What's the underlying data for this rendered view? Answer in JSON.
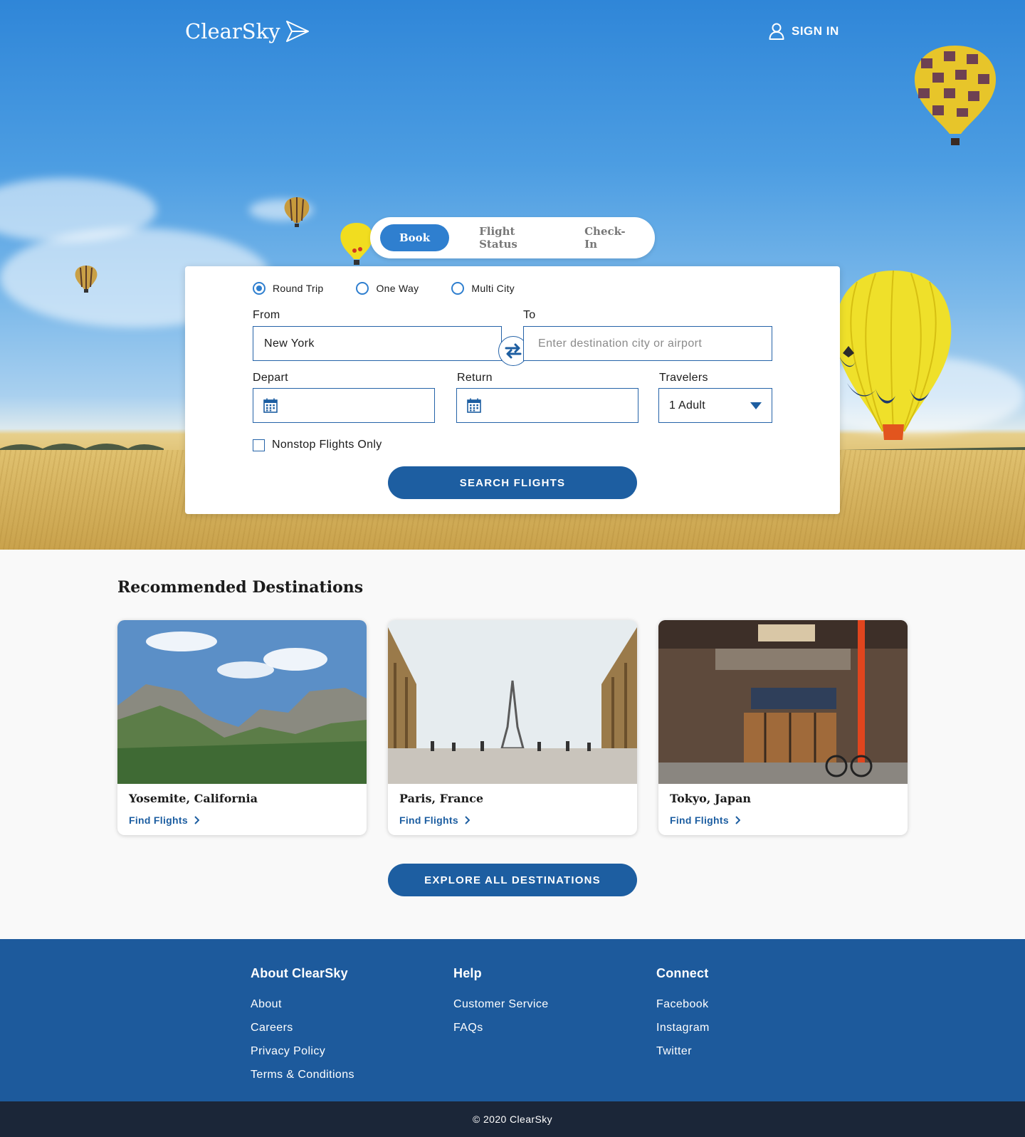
{
  "header": {
    "logo_text": "ClearSky",
    "logo_icon": "paper-plane-icon",
    "signin_label": "SIGN IN",
    "signin_icon": "user-icon"
  },
  "booking_tabs": [
    {
      "label": "Book",
      "active": true
    },
    {
      "label": "Flight Status",
      "active": false
    },
    {
      "label": "Check-In",
      "active": false
    }
  ],
  "trip_types": [
    {
      "label": "Round Trip",
      "selected": true
    },
    {
      "label": "One Way",
      "selected": false
    },
    {
      "label": "Multi City",
      "selected": false
    }
  ],
  "form": {
    "from_label": "From",
    "from_value": "New York",
    "to_label": "To",
    "to_placeholder": "Enter destination city or airport",
    "depart_label": "Depart",
    "return_label": "Return",
    "travelers_label": "Travelers",
    "travelers_value": "1 Adult",
    "nonstop_label": "Nonstop Flights Only",
    "search_button": "SEARCH FLIGHTS"
  },
  "destinations": {
    "title": "Recommended Destinations",
    "items": [
      {
        "name": "Yosemite, California",
        "link": "Find Flights"
      },
      {
        "name": "Paris, France",
        "link": "Find Flights"
      },
      {
        "name": "Tokyo, Japan",
        "link": "Find Flights"
      }
    ],
    "explore_button": "EXPLORE ALL DESTINATIONS"
  },
  "footer": {
    "columns": [
      {
        "title": "About ClearSky",
        "links": [
          "About",
          "Careers",
          "Privacy Policy",
          "Terms & Conditions"
        ]
      },
      {
        "title": "Help",
        "links": [
          "Customer Service",
          "FAQs"
        ]
      },
      {
        "title": "Connect",
        "links": [
          "Facebook",
          "Instagram",
          "Twitter"
        ]
      }
    ],
    "copyright": "© 2020 ClearSky"
  },
  "colors": {
    "primary": "#1d5ea1",
    "accent": "#2f7fcf",
    "footer": "#1d5a9c",
    "bottom_bar": "#1b2638"
  }
}
